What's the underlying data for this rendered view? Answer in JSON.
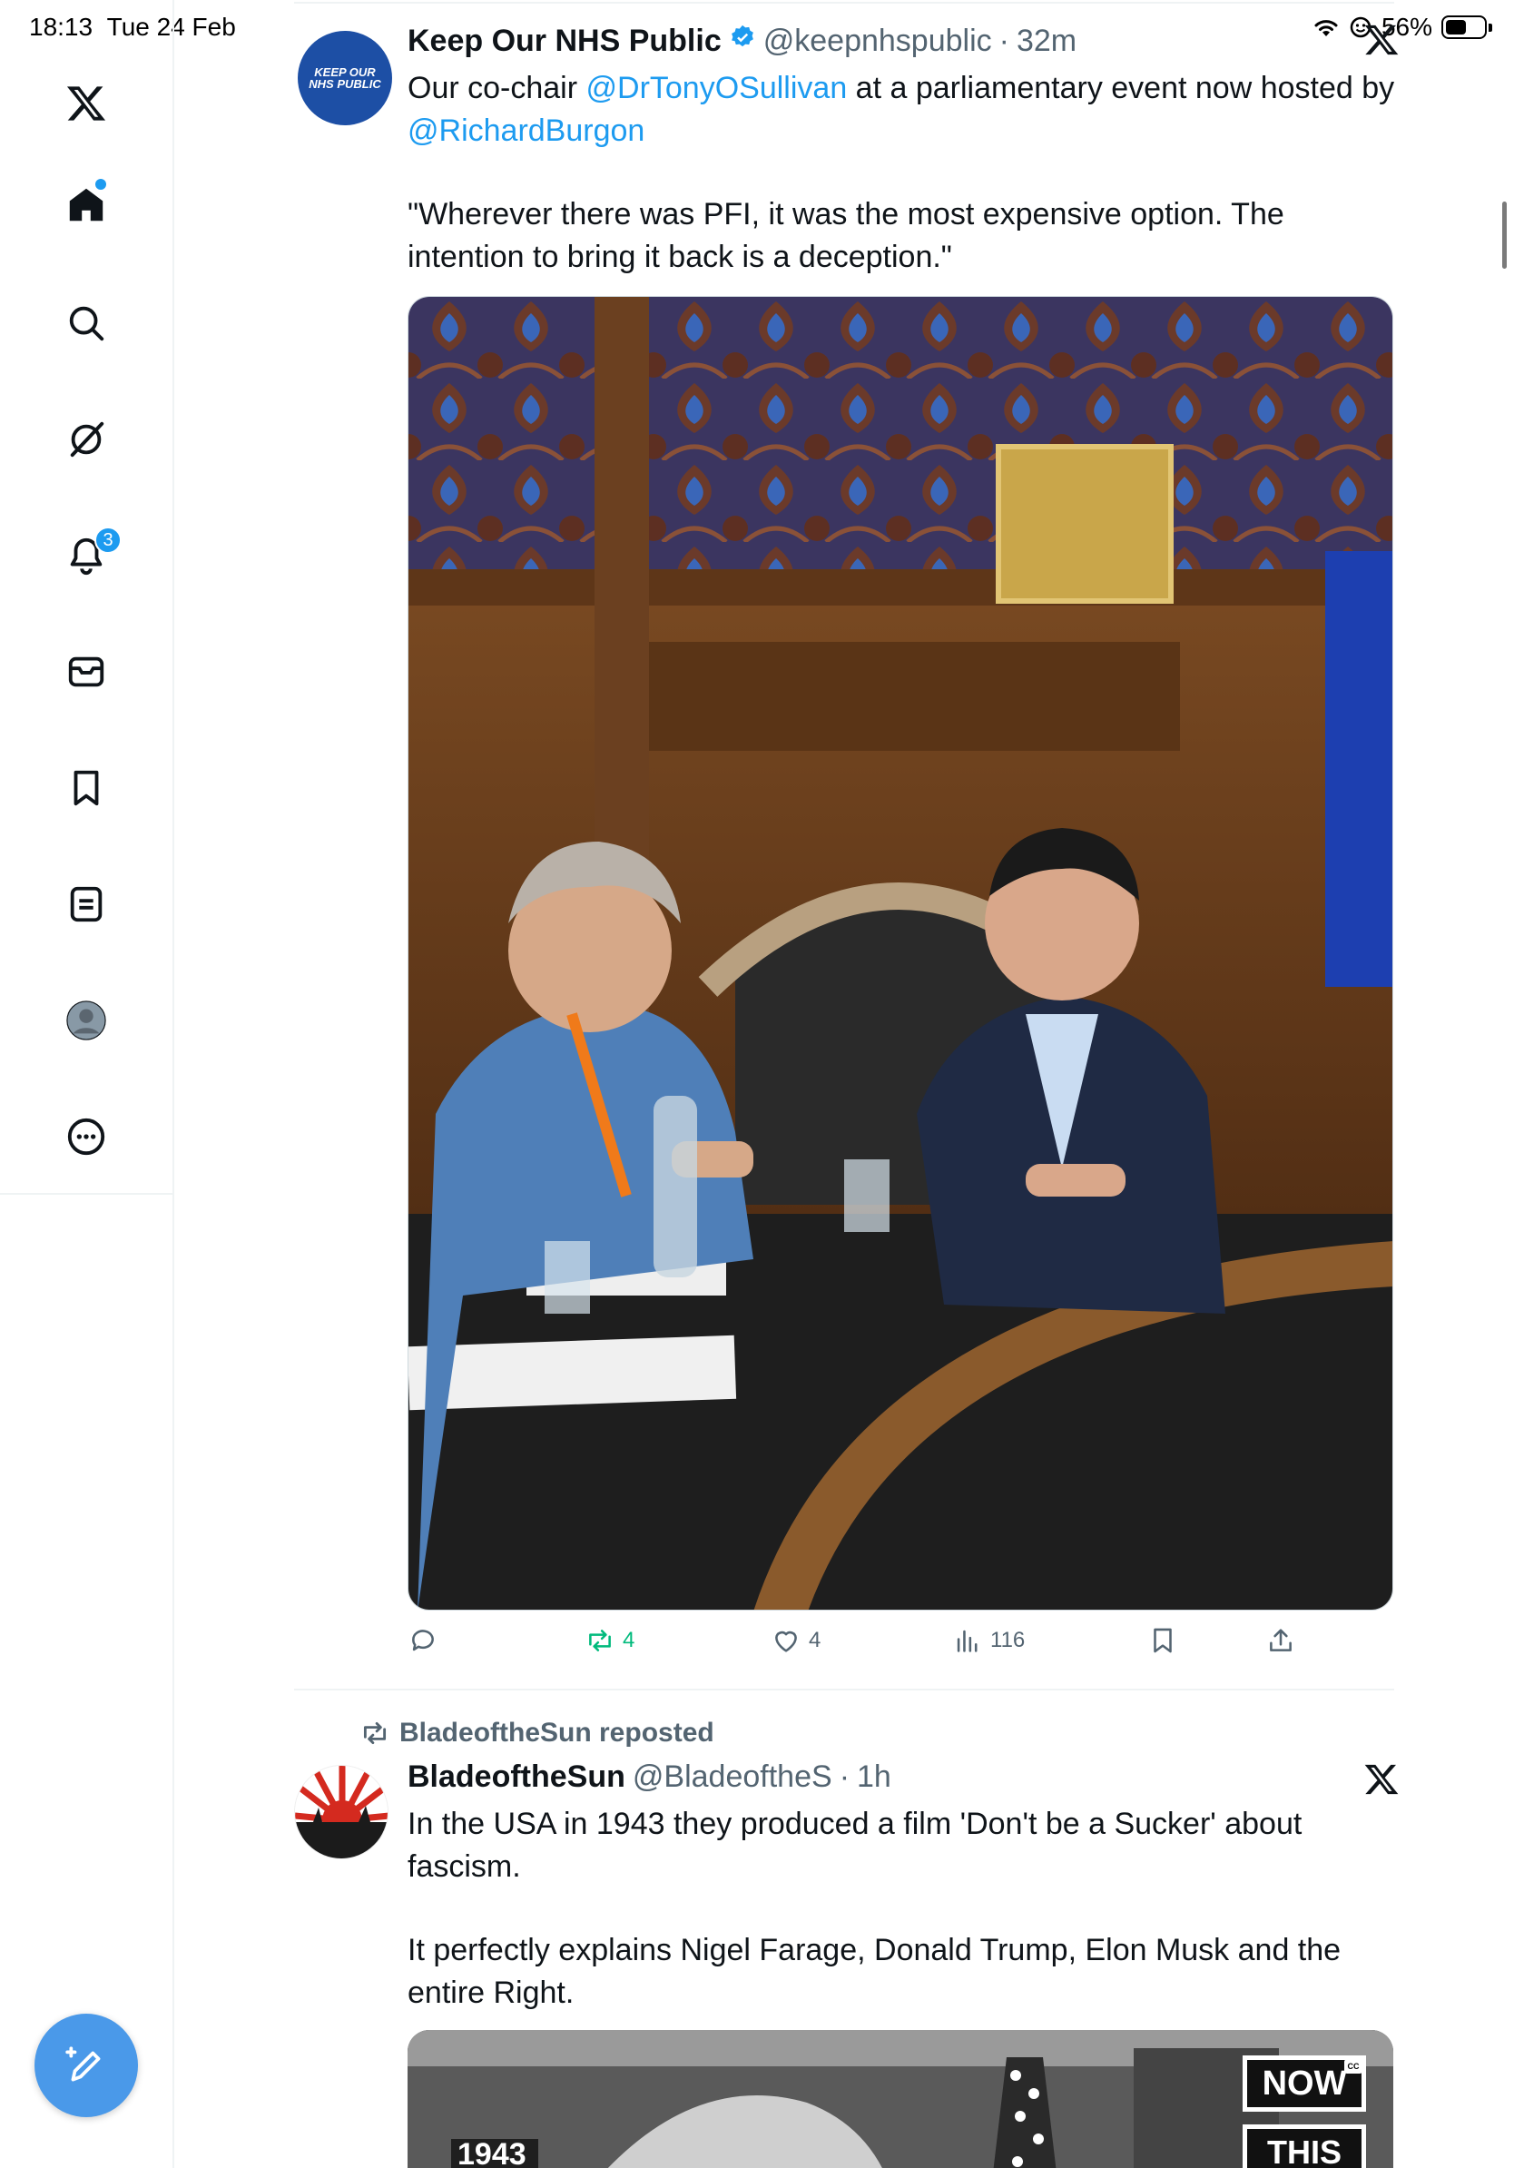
{
  "status_bar": {
    "time": "18:13",
    "date": "Tue 24 Feb",
    "battery": "56%",
    "battery_level": 0.56
  },
  "sidebar": {
    "items": [
      {
        "name": "x-logo-icon"
      },
      {
        "name": "home-icon"
      },
      {
        "name": "search-icon"
      },
      {
        "name": "grok-icon"
      },
      {
        "name": "notifications-icon",
        "badge": "3"
      },
      {
        "name": "messages-icon"
      },
      {
        "name": "bookmarks-icon"
      },
      {
        "name": "lists-icon"
      },
      {
        "name": "profile-icon"
      },
      {
        "name": "more-icon"
      }
    ],
    "compose": "compose-icon"
  },
  "tweets": [
    {
      "name": "Keep Our NHS Public",
      "handle": "@keepnhspublic",
      "sep": "·",
      "time": "32m",
      "avatar_text_1": "KEEP OUR",
      "avatar_text_2": "NHS PUBLIC",
      "text_a": "Our co-chair ",
      "mention_1": "@DrTonyOSullivan",
      "text_b": " at a parliamentary event now hosted by ",
      "mention_2": "@RichardBurgon",
      "quote": "\"Wherever there was PFI, it was the most expensive option. The intention to bring it back is a deception.\"",
      "replies": "",
      "reposts": "4",
      "likes": "4",
      "views": "116"
    },
    {
      "repost_label": "BladeoftheSun reposted",
      "name": "BladeoftheSun",
      "handle": "@BladeoftheS",
      "sep": "·",
      "time": "1h",
      "para_1": "In the USA in 1943 they produced a film 'Don't be a Sucker' about fascism.",
      "para_2": "It perfectly explains Nigel Farage, Donald Trump, Elon Musk and the entire Right.",
      "video_year": "1943",
      "video_badge_1": "NOW",
      "video_badge_2": "THIS",
      "cc": "CC"
    }
  ],
  "colors": {
    "accent": "#1d9bf0",
    "repost_green": "#00ba7c",
    "muted": "#536471",
    "compose_bg": "#4a99e9"
  }
}
